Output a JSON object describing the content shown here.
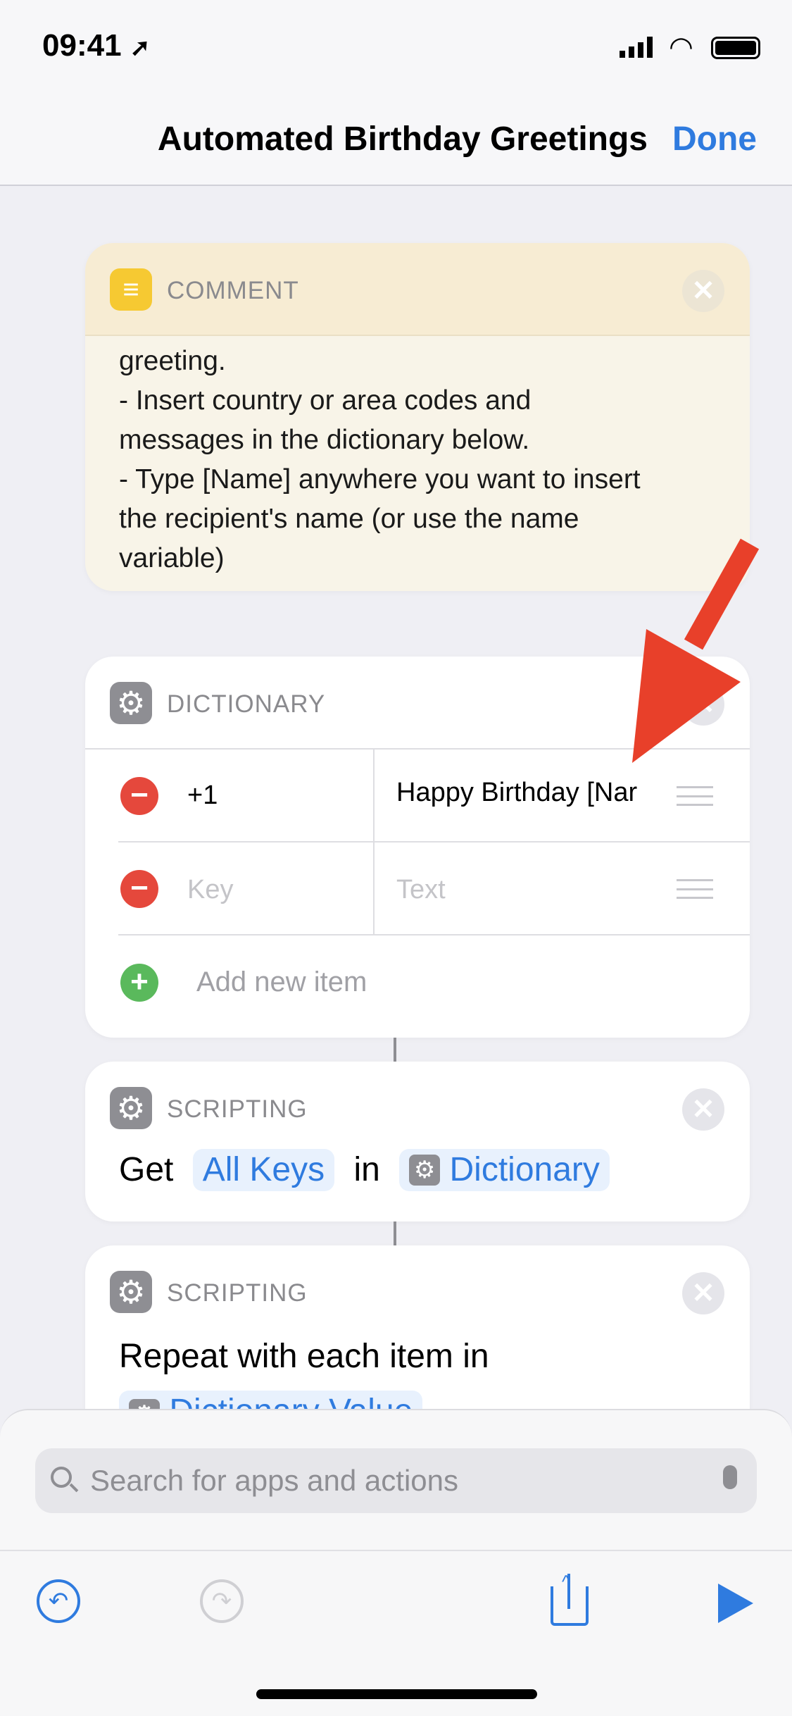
{
  "status": {
    "time": "09:41"
  },
  "nav": {
    "title": "Automated Birthday Greetings",
    "done": "Done"
  },
  "comment": {
    "label": "COMMENT",
    "lines": [
      "greeting.",
      "- Insert country or area codes and",
      "messages in the dictionary below.",
      "- Type [Name] anywhere you want to insert",
      "the recipient's name (or use the name",
      "variable)"
    ]
  },
  "dictionary": {
    "label": "DICTIONARY",
    "rows": [
      {
        "key": "+1",
        "value": "Happy Birthday [Nar"
      },
      {
        "key_placeholder": "Key",
        "value_placeholder": "Text"
      }
    ],
    "add": "Add new item"
  },
  "get_action": {
    "label": "SCRIPTING",
    "word1": "Get",
    "token1": "All Keys",
    "word2": "in",
    "token2": "Dictionary"
  },
  "repeat_action": {
    "label": "SCRIPTING",
    "text": "Repeat with each item in",
    "token": "Dictionary Value"
  },
  "search": {
    "placeholder": "Search for apps and actions"
  },
  "colors": {
    "accent": "#2f7bdf",
    "annotation_arrow": "#e8402a",
    "delete": "#e5483c",
    "add": "#5ab95c",
    "comment_header": "#f7ecd3",
    "comment_body": "#f8f4e8"
  }
}
